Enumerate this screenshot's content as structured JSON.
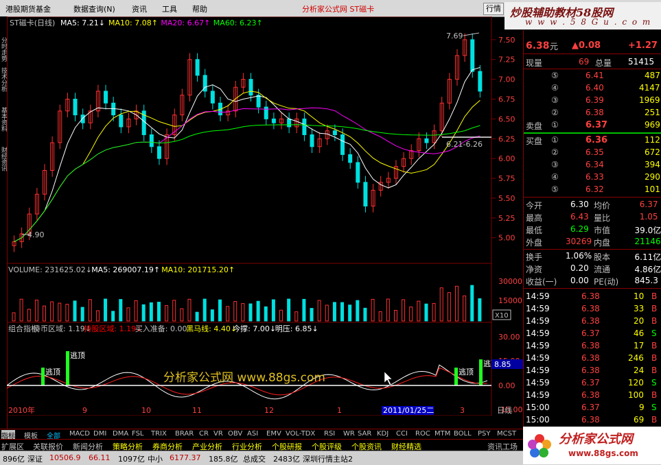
{
  "menubar": {
    "items": [
      "港股期货基金",
      "数据查询(N)",
      "资讯",
      "工具",
      "帮助"
    ],
    "app_title": "分析家公式网 ST磁卡",
    "hq_button": "行情",
    "watermark_line1": "炒股辅助教材58股网",
    "watermark_line2": "w w w . 5 8 G u . c o m"
  },
  "left_tabs": [
    "分时走势",
    "技术分析",
    "基本资料",
    "财经资讯"
  ],
  "main_chart": {
    "title": "ST磁卡(日线)",
    "ma_legend": [
      {
        "label": "MA5: 7.21",
        "arrow": "↓",
        "color": "#ffffff"
      },
      {
        "label": "MA10: 7.08",
        "arrow": "↑",
        "color": "#ffff00"
      },
      {
        "label": "MA20: 6.67",
        "arrow": "↑",
        "color": "#ff00ff"
      },
      {
        "label": "MA60: 6.23",
        "arrow": "↑",
        "color": "#00ff00"
      }
    ],
    "price_ticks": [
      "7.50",
      "7.25",
      "7.00",
      "6.75",
      "6.50",
      "6.25",
      "6.00",
      "5.75",
      "5.50",
      "5.25",
      "5.00"
    ],
    "high_label": "7.69",
    "low_label": "4.90",
    "current_line_label": "6.21-6.26"
  },
  "volume_panel": {
    "legend": [
      {
        "label": "VOLUME: 231625.02",
        "arrow": "↓",
        "color": "#c0c0c0"
      },
      {
        "label": "MA5: 269007.19",
        "arrow": "↑",
        "color": "#ffffff"
      },
      {
        "label": "MA10: 201715.20",
        "arrow": "↑",
        "color": "#ffff00"
      }
    ],
    "ticks": [
      "30000",
      "15000"
    ],
    "unit": "X10"
  },
  "indicator_panel": {
    "legend": [
      {
        "label": "组合指标",
        "color": "#c0c0c0"
      },
      {
        "label": "持币区域: 1.19",
        "arrow": "↓",
        "color": "#c0c0c0"
      },
      {
        "label": "持股区域: 1.19",
        "arrow": "↓",
        "color": "#ff0000"
      },
      {
        "label": "买入准备: 0.00",
        "color": "#c0c0c0"
      },
      {
        "label": "黑马线: 4.40",
        "arrow": "↓",
        "color": "#ffff00"
      },
      {
        "label": "今撑: 7.00",
        "arrow": "↓",
        "color": "#ffffff"
      },
      {
        "label": "明压: 6.85",
        "arrow": "↓",
        "color": "#ffffff"
      }
    ],
    "ticks": [
      "30.00",
      "15.00",
      "0.00",
      "-15.00"
    ],
    "current_value": "8.85",
    "labels": [
      "逃顶",
      "逃顶",
      "逃顶",
      "逃顶"
    ],
    "watermark": "分析家公式网 www.88gs.com"
  },
  "time_axis": {
    "labels": [
      "2010年",
      "9",
      "10",
      "11",
      "12",
      "1",
      "2011/01/25二",
      "3"
    ],
    "period": "日线"
  },
  "quote": {
    "price": "6.38",
    "price_unit": "元",
    "change": "▲0.08",
    "change_pct": "+1.27",
    "now_vol_label": "现量",
    "now_vol": "69",
    "total_vol_label": "总量",
    "total_vol": "51415",
    "sell": [
      {
        "level": "⑤",
        "price": "6.41",
        "vol": "487"
      },
      {
        "level": "④",
        "price": "6.40",
        "vol": "4147"
      },
      {
        "level": "③",
        "price": "6.39",
        "vol": "1969"
      },
      {
        "level": "②",
        "price": "6.38",
        "vol": "251"
      },
      {
        "level": "①",
        "price": "6.37",
        "vol": "969",
        "label": "卖盘"
      }
    ],
    "buy": [
      {
        "level": "①",
        "price": "6.36",
        "vol": "112",
        "label": "买盘"
      },
      {
        "level": "②",
        "price": "6.35",
        "vol": "672"
      },
      {
        "level": "③",
        "price": "6.34",
        "vol": "394"
      },
      {
        "level": "④",
        "price": "6.33",
        "vol": "290"
      },
      {
        "level": "⑤",
        "price": "6.32",
        "vol": "101"
      }
    ],
    "stats": [
      {
        "l1": "今开",
        "v1": "6.30",
        "c1": "#ffffff",
        "l2": "均价",
        "v2": "6.37",
        "c2": "#ff4040"
      },
      {
        "l1": "最高",
        "v1": "6.43",
        "c1": "#ff4040",
        "l2": "量比",
        "v2": "1.05",
        "c2": "#ff4040"
      },
      {
        "l1": "最低",
        "v1": "6.29",
        "c1": "#00ff00",
        "l2": "市值",
        "v2": "39.0亿",
        "c2": "#ffffff"
      },
      {
        "l1": "外盘",
        "v1": "30269",
        "c1": "#ff4040",
        "l2": "内盘",
        "v2": "21146",
        "c2": "#00ff00"
      }
    ],
    "stats2": [
      {
        "l1": "换手",
        "v1": "1.06%",
        "l2": "股本",
        "v2": "6.11亿"
      },
      {
        "l1": "净资",
        "v1": "0.20",
        "l2": "流通",
        "v2": "4.86亿"
      },
      {
        "l1": "收益(一)",
        "v1": "0.00",
        "l2": "PE(动)",
        "v2": "845.3"
      }
    ],
    "ticks": [
      {
        "time": "14:59",
        "price": "6.38",
        "vol": "10",
        "side": "B"
      },
      {
        "time": "14:59",
        "price": "6.38",
        "vol": "33",
        "side": "B"
      },
      {
        "time": "14:59",
        "price": "6.38",
        "vol": "20",
        "side": "B"
      },
      {
        "time": "14:59",
        "price": "6.37",
        "vol": "46",
        "side": "S"
      },
      {
        "time": "14:59",
        "price": "6.38",
        "vol": "17",
        "side": "B"
      },
      {
        "time": "14:59",
        "price": "6.38",
        "vol": "246",
        "side": "B"
      },
      {
        "time": "14:59",
        "price": "6.38",
        "vol": "24",
        "side": "B"
      },
      {
        "time": "14:59",
        "price": "6.37",
        "vol": "120",
        "side": "S"
      },
      {
        "time": "14:59",
        "price": "6.38",
        "vol": "100",
        "side": "B"
      },
      {
        "time": "15:00",
        "price": "6.37",
        "vol": "9",
        "side": "S"
      },
      {
        "time": "15:00",
        "price": "6.38",
        "vol": "69",
        "side": "B"
      }
    ]
  },
  "indicator_tabs": [
    "指标",
    "模板",
    "全部",
    "MACD",
    "DMI",
    "DMA",
    "FSL",
    "TRIX",
    "BRAR",
    "CR",
    "VR",
    "OBV",
    "ASI",
    "EMV",
    "VOL-TDX",
    "RSI",
    "WR",
    "SAR",
    "KDJ",
    "CCI",
    "ROC",
    "MTM",
    "BOLL",
    "PSY",
    "MCST"
  ],
  "sector_tabs": [
    "扩展区",
    "关联报价",
    "新闻分析",
    "策略分析",
    "券商分析",
    "产业分析",
    "行业分析",
    "个股研报",
    "个股评级",
    "个股资讯",
    "财经精选"
  ],
  "sector_right": "资讯工场",
  "statusbar": {
    "items": [
      "896亿",
      "深证",
      "10506.9",
      "66.11",
      "1097亿",
      "中小",
      "6177.37",
      "185.8亿",
      "总成交",
      "2483亿",
      "深圳行情主站2"
    ]
  },
  "brand": {
    "name": "分析家公式网",
    "url": "www.88gs.com"
  },
  "chart_data": {
    "type": "line",
    "candles_close": [
      4.95,
      5.05,
      5.3,
      5.55,
      5.85,
      6.2,
      6.6,
      6.75,
      6.55,
      6.45,
      6.6,
      6.85,
      6.7,
      6.55,
      6.4,
      6.5,
      6.6,
      6.3,
      6.15,
      6.0,
      6.3,
      6.55,
      6.8,
      7.25,
      7.05,
      6.85,
      6.7,
      6.55,
      6.6,
      6.9,
      7.0,
      6.8,
      6.65,
      6.5,
      6.45,
      6.5,
      6.4,
      6.5,
      6.3,
      6.15,
      6.25,
      6.35,
      6.3,
      6.05,
      5.95,
      5.7,
      5.4,
      5.6,
      5.7,
      5.75,
      5.9,
      6.0,
      6.1,
      6.25,
      6.2,
      6.35,
      6.7,
      7.0,
      7.3,
      7.5,
      7.1,
      6.85
    ],
    "y_range": [
      4.9,
      7.69
    ]
  }
}
